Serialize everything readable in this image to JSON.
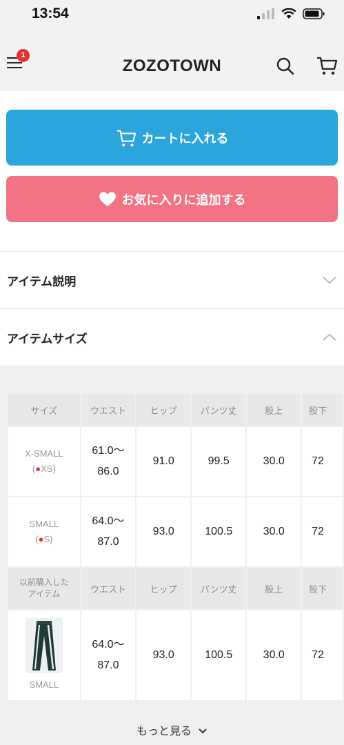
{
  "status_bar": {
    "time": "13:54"
  },
  "header": {
    "logo": "ZOZOTOWN",
    "menu_badge": "1",
    "icons": [
      "menu-icon",
      "search-icon",
      "cart-icon"
    ]
  },
  "actions": {
    "cart_label": "カートに入れる",
    "favorite_label": "お気に入りに追加する",
    "cart_color": "#2aa6dc",
    "favorite_color": "#f27384"
  },
  "sections": {
    "description_title": "アイテム説明",
    "size_title": "アイテムサイズ"
  },
  "size_table": {
    "headers": [
      "サイズ",
      "ウエスト",
      "ヒップ",
      "パンツ丈",
      "股上",
      "股下"
    ],
    "rows": [
      {
        "size": "X-SMALL",
        "tag": "XS",
        "waist": "61.0〜\n86.0",
        "hip": "91.0",
        "length": "99.5",
        "rise": "30.0",
        "inseam": "72"
      },
      {
        "size": "SMALL",
        "tag": "S",
        "waist": "64.0〜\n87.0",
        "hip": "93.0",
        "length": "100.5",
        "rise": "30.0",
        "inseam": "72"
      }
    ],
    "previous": {
      "label": "以前購入した\nアイテム",
      "headers": [
        "ウエスト",
        "ヒップ",
        "パンツ丈",
        "股上",
        "股下"
      ],
      "row": {
        "size": "SMALL",
        "waist": "64.0〜\n87.0",
        "hip": "93.0",
        "length": "100.5",
        "rise": "30.0",
        "inseam": "72"
      }
    }
  },
  "more_label": "もっと見る"
}
